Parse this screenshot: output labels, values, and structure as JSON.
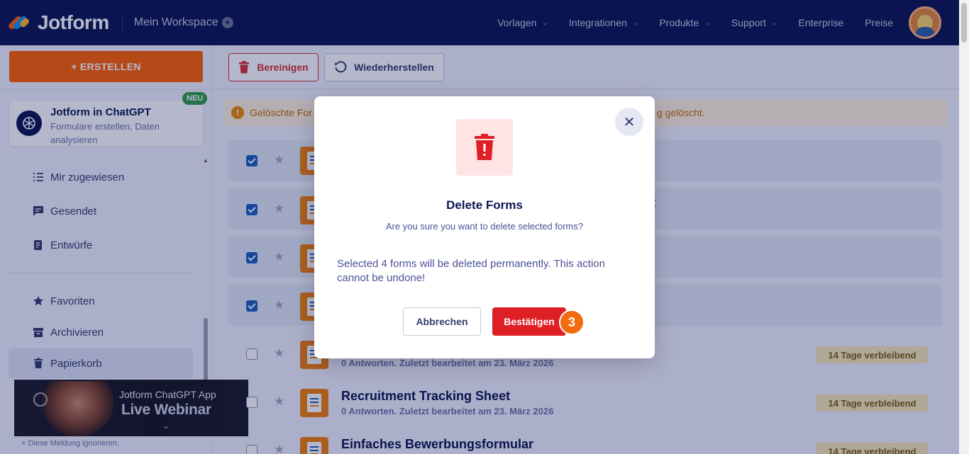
{
  "header": {
    "logo_text": "Jotform",
    "workspace": "Mein Workspace",
    "nav": [
      {
        "label": "Vorlagen",
        "has_dropdown": true
      },
      {
        "label": "Integrationen",
        "has_dropdown": true
      },
      {
        "label": "Produkte",
        "has_dropdown": true
      },
      {
        "label": "Support",
        "has_dropdown": true
      },
      {
        "label": "Enterprise",
        "has_dropdown": false
      },
      {
        "label": "Preise",
        "has_dropdown": false
      }
    ]
  },
  "sidebar": {
    "create_label": "+ ERSTELLEN",
    "promo": {
      "title": "Jotform in ChatGPT",
      "subtitle": "Formulare erstellen, Daten analysieren",
      "badge": "NEU"
    },
    "items": [
      {
        "label": "Mir zugewiesen",
        "icon": "assigned-list-icon"
      },
      {
        "label": "Gesendet",
        "icon": "sent-message-icon"
      },
      {
        "label": "Entwürfe",
        "icon": "drafts-icon"
      },
      {
        "label": "Favoriten",
        "icon": "star-icon"
      },
      {
        "label": "Archivieren",
        "icon": "archive-icon"
      },
      {
        "label": "Papierkorb",
        "icon": "trash-icon",
        "active": true
      }
    ],
    "webinar": {
      "line1": "Jotform ChatGPT App",
      "line2": "Live Webinar"
    },
    "dismiss": "× Diese Meldung ignorieren."
  },
  "toolbar": {
    "clean_label": "Bereinigen",
    "restore_label": "Wiederherstellen"
  },
  "warning": {
    "text_left": "Gelöschte For",
    "text_right": "g gelöscht."
  },
  "forms": [
    {
      "title": "",
      "subtitle": "",
      "selected": true,
      "days": ""
    },
    {
      "title": "cht",
      "subtitle": "",
      "selected": true,
      "days": ""
    },
    {
      "title": "",
      "subtitle": "",
      "selected": true,
      "days": ""
    },
    {
      "title": "",
      "subtitle": "",
      "selected": true,
      "days": ""
    },
    {
      "title": "",
      "subtitle": "0 Antworten. Zuletzt bearbeitet am 23. März 2026",
      "selected": false,
      "days": "14 Tage verbleibend"
    },
    {
      "title": "Recruitment Tracking Sheet",
      "subtitle": "0 Antworten. Zuletzt bearbeitet am 23. März 2026",
      "selected": false,
      "days": "14 Tage verbleibend"
    },
    {
      "title": "Einfaches Bewerbungsformular",
      "subtitle": "",
      "selected": false,
      "days": "14 Tage verbleibend"
    }
  ],
  "modal": {
    "title": "Delete Forms",
    "subtitle": "Are you sure you want to delete selected forms?",
    "body": "Selected 4 forms will be deleted permanently. This action cannot be undone!",
    "cancel_label": "Abbrechen",
    "confirm_label": "Bestätigen",
    "step_badge": "3"
  },
  "colors": {
    "nav_bg": "#0a1551",
    "accent_orange": "#ff6100",
    "danger_red": "#df1f26",
    "selected_row": "#e2e8f6",
    "checkbox_blue": "#1b5fbf"
  }
}
